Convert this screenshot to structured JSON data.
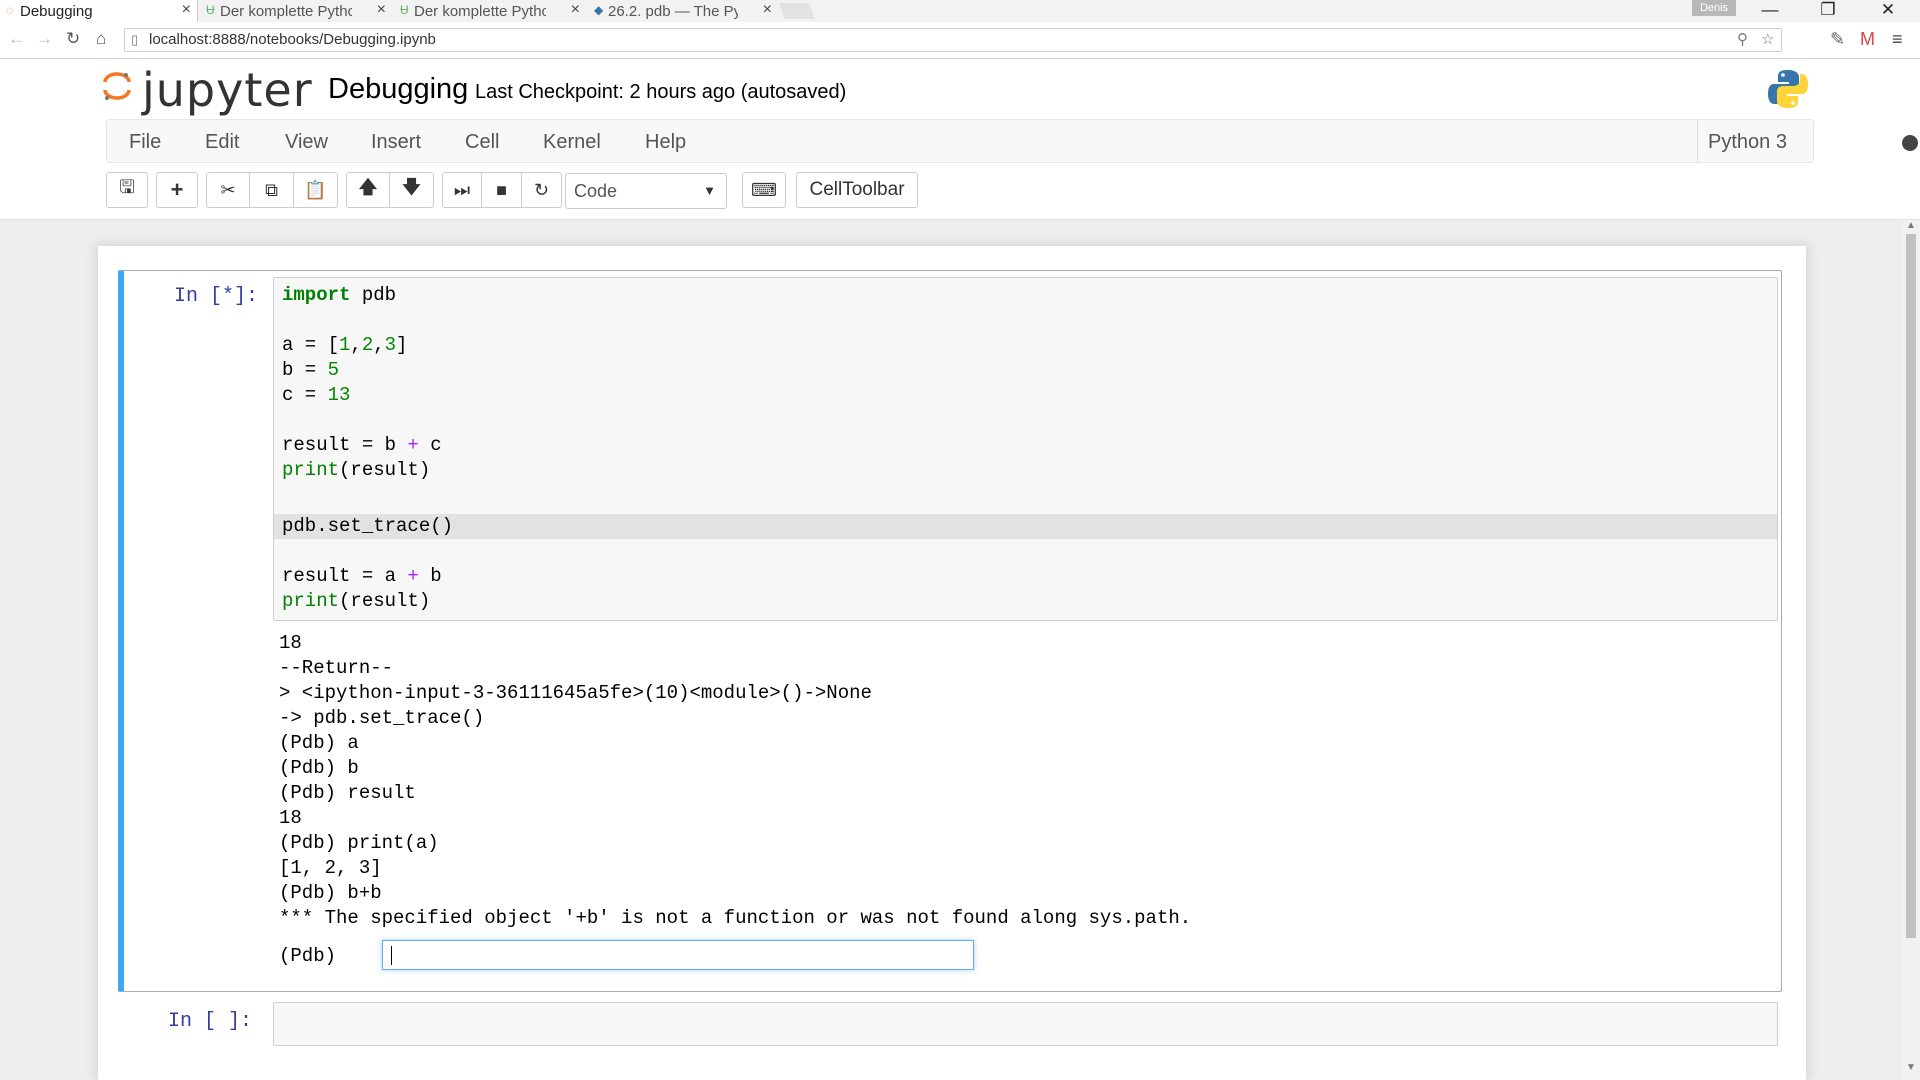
{
  "browser": {
    "tabs": [
      {
        "title": "Debugging",
        "icon": "jupyter-favicon"
      },
      {
        "title": "Der komplette Python",
        "icon": "udemy-favicon"
      },
      {
        "title": "Der komplette Python",
        "icon": "udemy-favicon"
      },
      {
        "title": "26.2. pdb — The Pyt",
        "icon": "python-favicon"
      }
    ],
    "user_badge": "Denis",
    "url": "localhost:8888/notebooks/Debugging.ipynb"
  },
  "header": {
    "logo_text": "jupyter",
    "notebook_title": "Debugging",
    "checkpoint": "Last Checkpoint: 2 hours ago (autosaved)"
  },
  "menu": {
    "items": [
      "File",
      "Edit",
      "View",
      "Insert",
      "Cell",
      "Kernel",
      "Help"
    ],
    "kernel_name": "Python 3"
  },
  "toolbar": {
    "cell_type": "Code",
    "celltoolbar_label": "CellToolbar"
  },
  "cells": {
    "cell1": {
      "prompt": "In [*]:",
      "output_lines": [
        "18",
        "--Return--",
        "> <ipython-input-3-36111645a5fe>(10)<module>()->None",
        "-> pdb.set_trace()",
        "(Pdb) a",
        "(Pdb) b",
        "(Pdb) result",
        "18",
        "(Pdb) print(a)",
        "[1, 2, 3]",
        "(Pdb) b+b",
        "*** The specified object '+b' is not a function or was not found along sys.path."
      ],
      "pdb_prompt": "(Pdb)",
      "pdb_input_value": ""
    },
    "cell2": {
      "prompt": "In [ ]:"
    }
  },
  "code": {
    "l1a": "import",
    "l1b": " pdb",
    "l3a": "a = [",
    "l3b": "1",
    "l3c": ",",
    "l3d": "2",
    "l3e": ",",
    "l3f": "3",
    "l3g": "]",
    "l4a": "b = ",
    "l4b": "5",
    "l5a": "c = ",
    "l5b": "13",
    "l7a": "result = b ",
    "l7b": "+",
    "l7c": " c",
    "l8a": "print",
    "l8b": "(result)",
    "l10": "pdb.set_trace()",
    "l12a": "result = a ",
    "l12b": "+",
    "l12c": " b",
    "l13a": "print",
    "l13b": "(result)"
  },
  "colors": {
    "selected_cell_border": "#42a5f5",
    "prompt": "#303f9f",
    "keyword": "#008000",
    "operator": "#aa22ff"
  }
}
